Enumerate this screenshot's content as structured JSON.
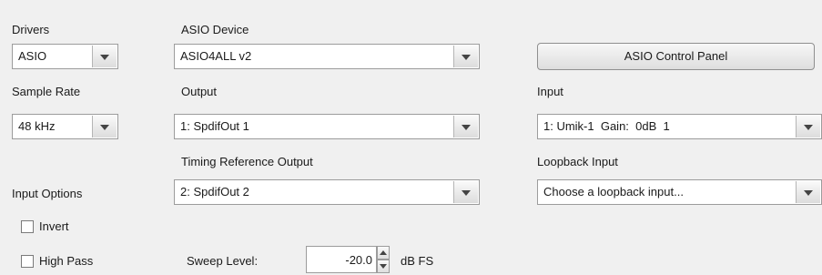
{
  "drivers": {
    "label": "Drivers",
    "value": "ASIO"
  },
  "asio_device": {
    "label": "ASIO Device",
    "value": "ASIO4ALL v2"
  },
  "control_panel_button": "ASIO Control Panel",
  "sample_rate": {
    "label": "Sample Rate",
    "value": "48 kHz"
  },
  "output": {
    "label": "Output",
    "value": "1: SpdifOut 1"
  },
  "input": {
    "label": "Input",
    "value": "1: Umik-1  Gain:  0dB  1"
  },
  "timing_reference_output": {
    "label": "Timing Reference Output",
    "value": "2: SpdifOut 2"
  },
  "loopback_input": {
    "label": "Loopback Input",
    "value": "Choose a loopback input..."
  },
  "input_options": {
    "label": "Input Options",
    "invert": {
      "label": "Invert",
      "checked": false
    },
    "high_pass": {
      "label": "High Pass",
      "checked": false
    }
  },
  "sweep_level": {
    "label": "Sweep Level:",
    "value": "-20.0",
    "unit": "dB FS"
  }
}
